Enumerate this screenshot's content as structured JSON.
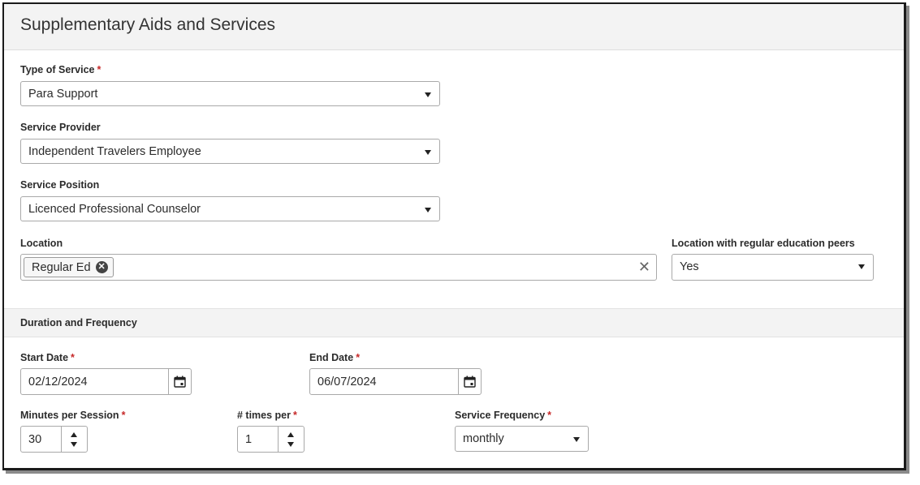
{
  "section": {
    "title": "Supplementary Aids and Services"
  },
  "type_of_service": {
    "label": "Type of Service",
    "required": "*",
    "value": "Para Support"
  },
  "service_provider": {
    "label": "Service Provider",
    "value": "Independent Travelers Employee"
  },
  "service_position": {
    "label": "Service Position",
    "value": "Licenced Professional Counselor"
  },
  "location": {
    "label": "Location",
    "chip": "Regular Ed",
    "clear": "✕"
  },
  "location_peers": {
    "label": "Location with regular education peers",
    "value": "Yes"
  },
  "duration": {
    "title": "Duration and Frequency"
  },
  "start_date": {
    "label": "Start Date",
    "required": "*",
    "value": "02/12/2024"
  },
  "end_date": {
    "label": "End Date",
    "required": "*",
    "value": "06/07/2024"
  },
  "minutes": {
    "label": "Minutes per Session",
    "required": "*",
    "value": "30"
  },
  "times_per": {
    "label": "# times per",
    "required": "*",
    "value": "1"
  },
  "frequency": {
    "label": "Service Frequency",
    "required": "*",
    "value": "monthly"
  },
  "icons": {
    "dropdown": "caret-down-icon",
    "calendar": "calendar-icon",
    "remove": "close-circle-icon",
    "clear": "close-icon"
  }
}
